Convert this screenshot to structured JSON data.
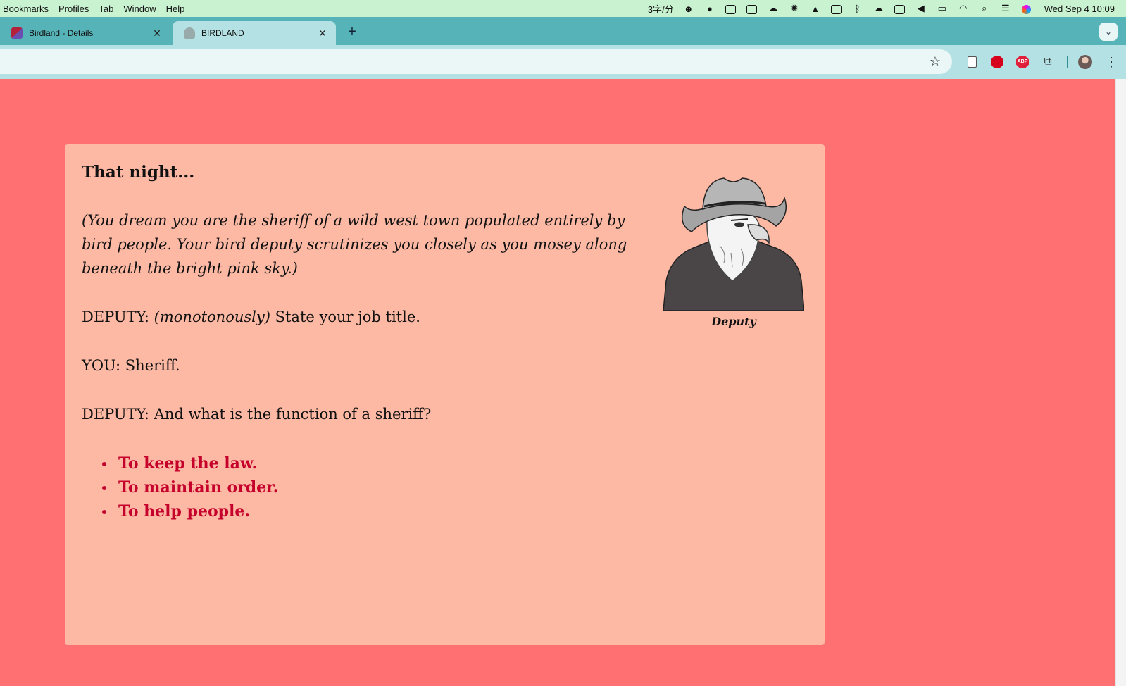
{
  "menubar": {
    "items": [
      "Bookmarks",
      "Profiles",
      "Tab",
      "Window",
      "Help"
    ],
    "input_method_rate": "3字/分",
    "clock": "Wed Sep 4  10:09"
  },
  "tabs": [
    {
      "title": "Birdland - Details",
      "favicon": "birdland-flag-icon",
      "close": "✕"
    },
    {
      "title": "BIRDLAND",
      "favicon": "bird-portrait-icon",
      "close": "✕"
    }
  ],
  "new_tab_label": "+",
  "page": {
    "heading": "That night...",
    "intro": "(You dream you are the sheriff of a wild west town populated entirely by bird people. Your bird deputy scrutinizes you closely as you mosey along beneath the bright pink sky.)",
    "line1": {
      "speaker": "DEPUTY:",
      "direction": "(monotonously)",
      "text": "State your job title."
    },
    "line2": "YOU: Sheriff.",
    "line3": "DEPUTY: And what is the function of a sheriff?",
    "options": [
      "To keep the law.",
      "To maintain order.",
      "To help people."
    ],
    "figure_caption": "Deputy"
  },
  "colors": {
    "background": "#ff7073",
    "card": "#fdb9a4",
    "option_link": "#c4002b",
    "tab_strip": "#56b3b8",
    "menubar": "#c9f2d0"
  }
}
